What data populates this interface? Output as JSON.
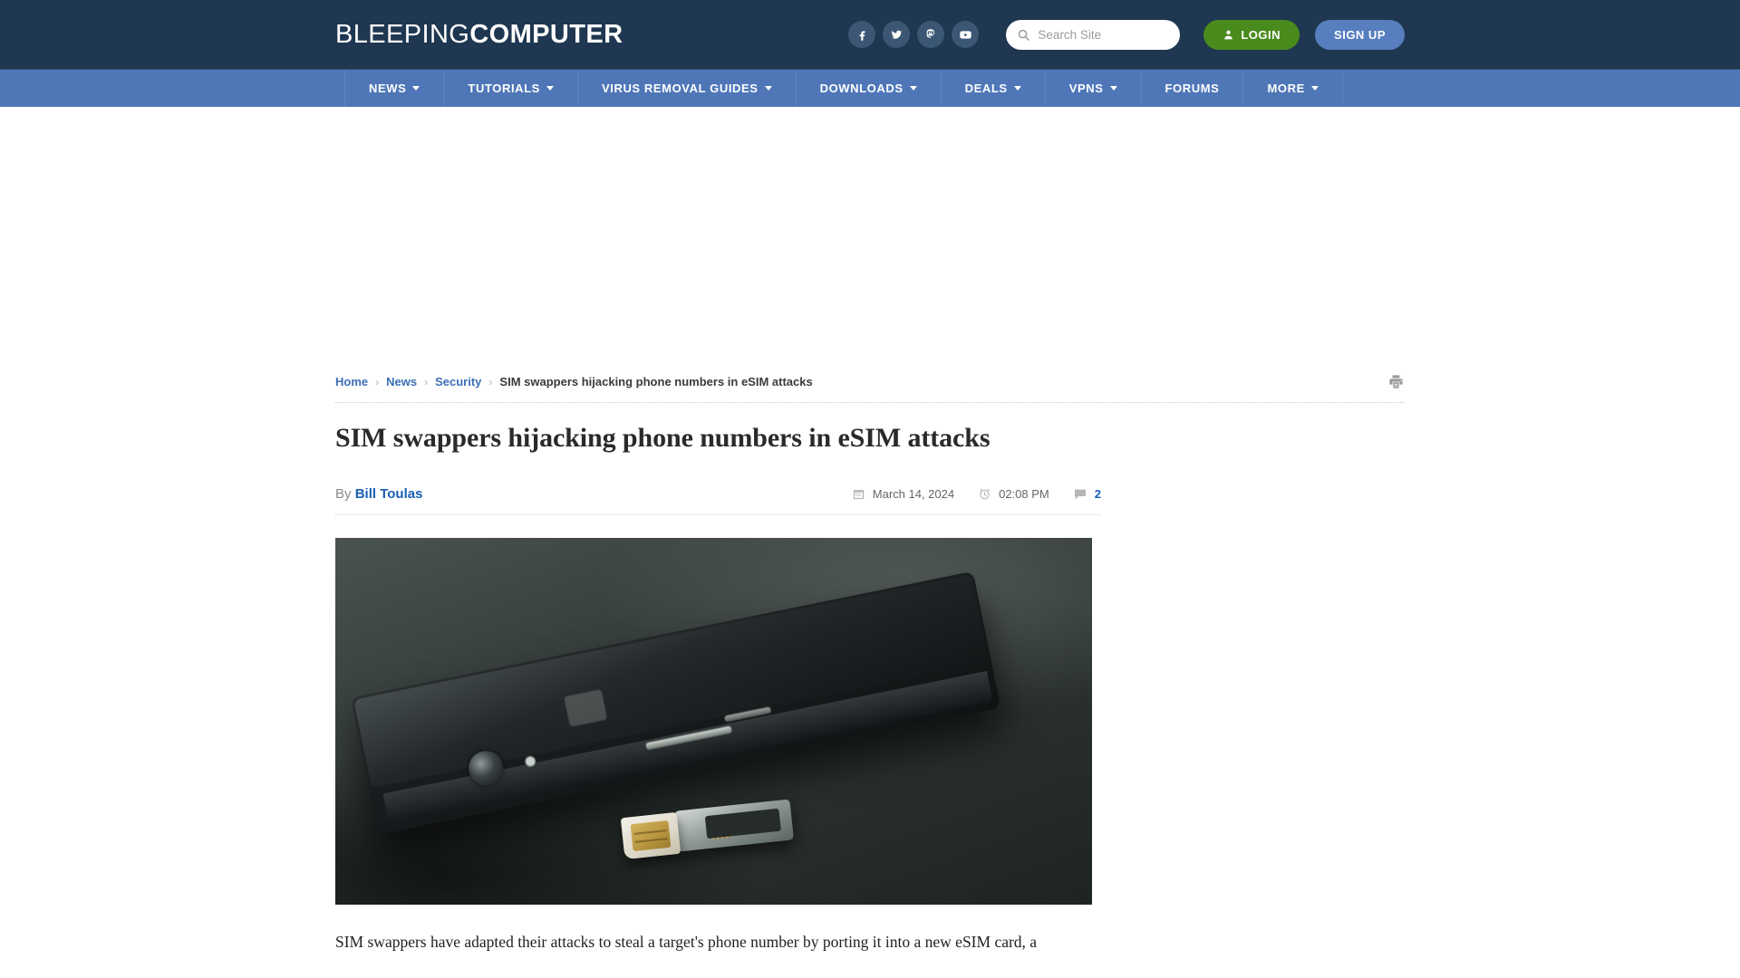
{
  "header": {
    "logo_light": "BLEEPING",
    "logo_bold": "COMPUTER",
    "social": [
      {
        "name": "facebook-icon",
        "label": "Facebook"
      },
      {
        "name": "twitter-icon",
        "label": "Twitter"
      },
      {
        "name": "mastodon-icon",
        "label": "Mastodon"
      },
      {
        "name": "youtube-icon",
        "label": "YouTube"
      }
    ],
    "search_placeholder": "Search Site",
    "search_value": "",
    "login_label": "LOGIN",
    "signup_label": "SIGN UP",
    "bg_color": "#1f3750",
    "login_color": "#4a8b1e",
    "signup_color": "#577fbf"
  },
  "nav": {
    "bg_color": "#4f77b8",
    "items": [
      {
        "label": "NEWS",
        "has_dropdown": true
      },
      {
        "label": "TUTORIALS",
        "has_dropdown": true
      },
      {
        "label": "VIRUS REMOVAL GUIDES",
        "has_dropdown": true
      },
      {
        "label": "DOWNLOADS",
        "has_dropdown": true
      },
      {
        "label": "DEALS",
        "has_dropdown": true
      },
      {
        "label": "VPNS",
        "has_dropdown": true
      },
      {
        "label": "FORUMS",
        "has_dropdown": false
      },
      {
        "label": "MORE",
        "has_dropdown": true
      }
    ]
  },
  "breadcrumb": {
    "items": [
      {
        "label": "Home",
        "is_link": true
      },
      {
        "label": "News",
        "is_link": true
      },
      {
        "label": "Security",
        "is_link": true
      },
      {
        "label": "SIM swappers hijacking phone numbers in eSIM attacks",
        "is_link": false
      }
    ],
    "separator": "›",
    "print_icon": "printer-icon"
  },
  "article": {
    "title": "SIM swappers hijacking phone numbers in eSIM attacks",
    "by_label": "By",
    "author": "Bill Toulas",
    "date": "March 14, 2024",
    "time": "02:08 PM",
    "comment_count": "2",
    "hero_image_alt": "Black smartphone lying face down on a dark surface with a nano SIM card and SIM tray beside it",
    "body_paragraph": "SIM swappers have adapted their attacks to steal a target's phone number by porting it into a new eSIM card, a"
  }
}
